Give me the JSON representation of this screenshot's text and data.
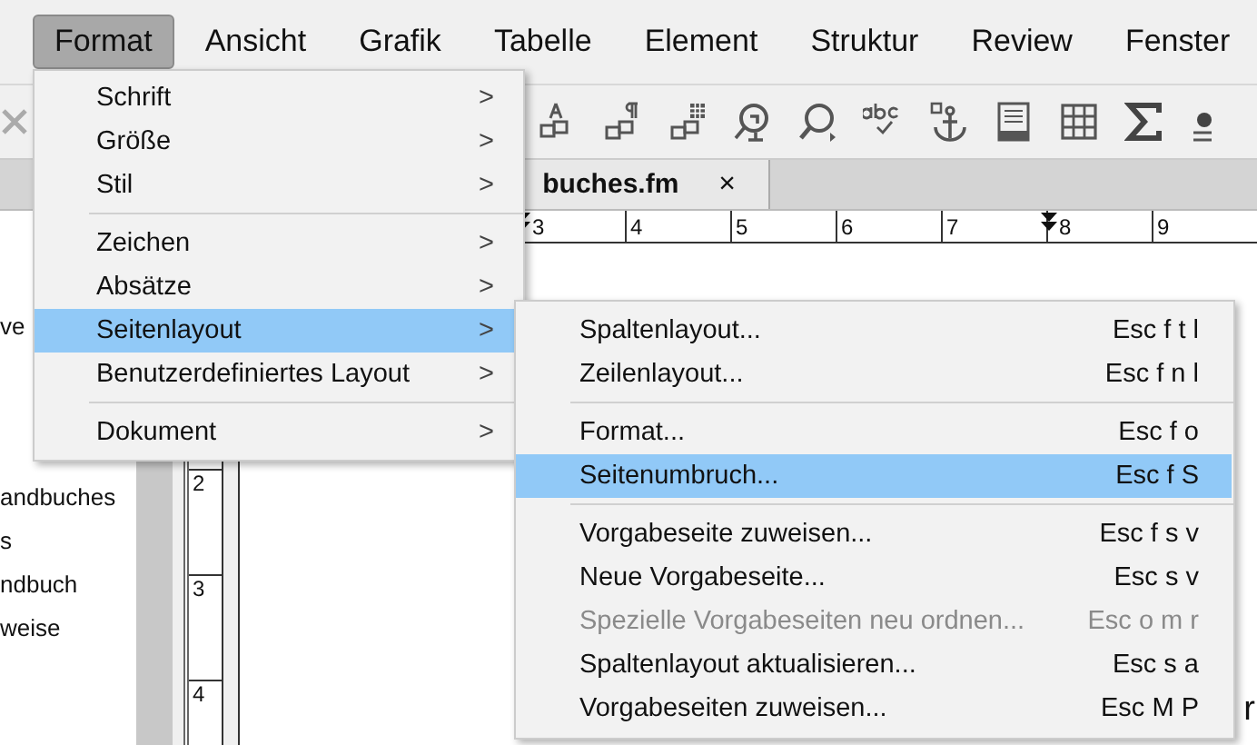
{
  "menu_bar": [
    {
      "label": "Format",
      "selected": true
    },
    {
      "label": "Ansicht",
      "selected": false
    },
    {
      "label": "Grafik",
      "selected": false
    },
    {
      "label": "Tabelle",
      "selected": false
    },
    {
      "label": "Element",
      "selected": false
    },
    {
      "label": "Struktur",
      "selected": false
    },
    {
      "label": "Review",
      "selected": false
    },
    {
      "label": "Fenster",
      "selected": false
    }
  ],
  "document_tab": {
    "label": "buches.fm",
    "close": "×"
  },
  "ruler": [
    "3",
    "4",
    "5",
    "6",
    "7",
    "8",
    "9"
  ],
  "vertical_ruler": [
    "2",
    "3",
    "4"
  ],
  "sidebar": {
    "items": [
      "ve",
      "andbuches",
      "s",
      "ndbuch",
      "weise"
    ]
  },
  "page_text": [
    "r"
  ],
  "format_menu": {
    "items": [
      {
        "kind": "item",
        "label": "Schrift",
        "arrow": ">",
        "selected": false
      },
      {
        "kind": "item",
        "label": "Größe",
        "arrow": ">",
        "selected": false
      },
      {
        "kind": "item",
        "label": "Stil",
        "arrow": ">",
        "selected": false
      },
      {
        "kind": "separator"
      },
      {
        "kind": "item",
        "label": "Zeichen",
        "arrow": ">",
        "selected": false
      },
      {
        "kind": "item",
        "label": "Absätze",
        "arrow": ">",
        "selected": false
      },
      {
        "kind": "item",
        "label": "Seitenlayout",
        "arrow": ">",
        "selected": true
      },
      {
        "kind": "item",
        "label": "Benutzerdefiniertes Layout",
        "arrow": ">",
        "selected": false
      },
      {
        "kind": "separator"
      },
      {
        "kind": "item",
        "label": "Dokument",
        "arrow": ">",
        "selected": false
      }
    ]
  },
  "submenu": {
    "items": [
      {
        "kind": "item",
        "label": "Spaltenlayout...",
        "shortcut": "Esc f t l",
        "selected": false,
        "disabled": false
      },
      {
        "kind": "item",
        "label": "Zeilenlayout...",
        "shortcut": "Esc f n l",
        "selected": false,
        "disabled": false
      },
      {
        "kind": "separator"
      },
      {
        "kind": "item",
        "label": "Format...",
        "shortcut": "Esc f o",
        "selected": false,
        "disabled": false
      },
      {
        "kind": "item",
        "label": "Seitenumbruch...",
        "shortcut": "Esc f S",
        "selected": true,
        "disabled": false
      },
      {
        "kind": "separator"
      },
      {
        "kind": "item",
        "label": "Vorgabeseite zuweisen...",
        "shortcut": "Esc f s v",
        "selected": false,
        "disabled": false
      },
      {
        "kind": "item",
        "label": "Neue Vorgabeseite...",
        "shortcut": "Esc s v",
        "selected": false,
        "disabled": false
      },
      {
        "kind": "item",
        "label": "Spezielle Vorgabeseiten neu ordnen...",
        "shortcut": "Esc o m r",
        "selected": false,
        "disabled": true
      },
      {
        "kind": "item",
        "label": "Spaltenlayout aktualisieren...",
        "shortcut": "Esc s a",
        "selected": false,
        "disabled": false
      },
      {
        "kind": "item",
        "label": "Vorgabeseiten zuweisen...",
        "shortcut": "Esc M P",
        "selected": false,
        "disabled": false
      }
    ]
  }
}
